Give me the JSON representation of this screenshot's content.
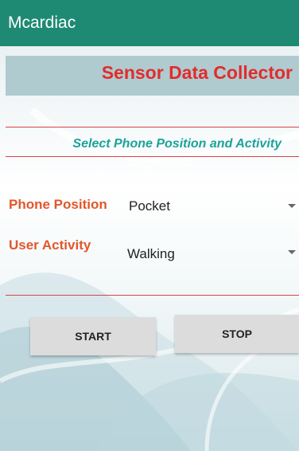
{
  "app_bar": {
    "title": "Mcardiac"
  },
  "banner": {
    "title": "Sensor Data Collector"
  },
  "section": {
    "title": "Select Phone Position and Activity"
  },
  "phone_position": {
    "label": "Phone Position",
    "value": "Pocket"
  },
  "user_activity": {
    "label": "User Activity",
    "value": "Walking"
  },
  "buttons": {
    "start": "START",
    "stop": "STOP"
  },
  "colors": {
    "app_bar": "#1f8a73",
    "banner_title": "#e21b1b",
    "section_title": "#1aa39b",
    "field_label": "#e2572a",
    "rule": "#d64545",
    "button_bg": "#dcdcdc"
  }
}
